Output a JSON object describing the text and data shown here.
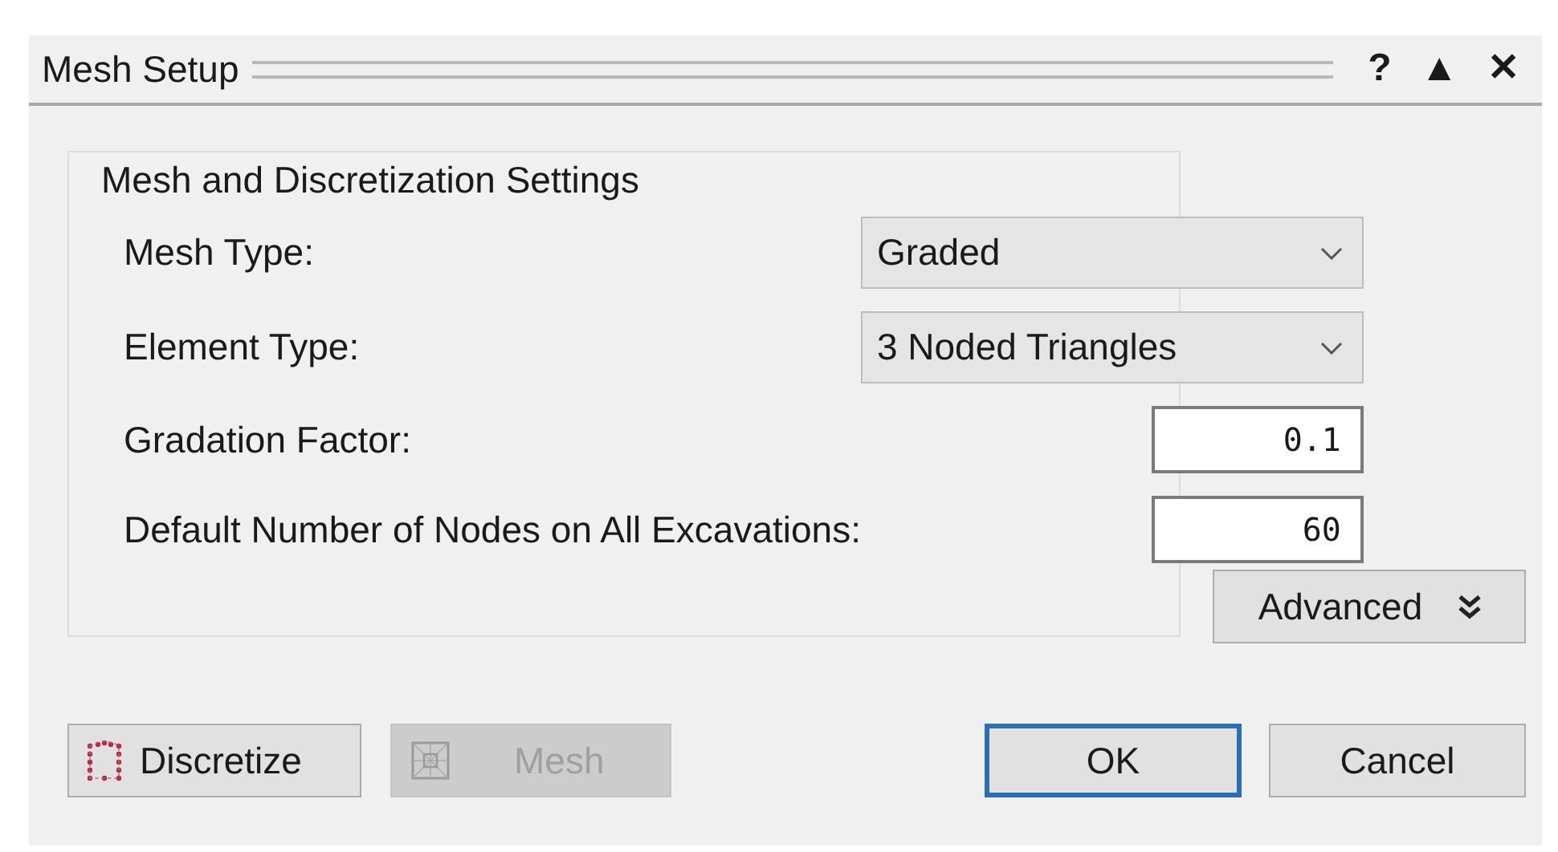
{
  "window": {
    "title": "Mesh Setup",
    "help": "?",
    "collapse": "▲",
    "close": "✕"
  },
  "settings": {
    "title": "Mesh and Discretization Settings",
    "fields": [
      {
        "kind": "dropdown",
        "label": "Mesh Type:",
        "value": "Graded"
      },
      {
        "kind": "dropdown",
        "label": "Element Type:",
        "value": "3 Noded Triangles"
      },
      {
        "kind": "number",
        "label": "Gradation Factor:",
        "value": "0.1"
      },
      {
        "kind": "number",
        "label": "Default Number of Nodes on All Excavations:",
        "value": "60"
      }
    ]
  },
  "advanced": {
    "label": "Advanced",
    "expanded": false
  },
  "buttons": [
    {
      "label": "Discretize",
      "kind": "discretize",
      "disabled": false,
      "default": false
    },
    {
      "label": "Mesh",
      "kind": "mesh",
      "disabled": true,
      "default": false
    },
    {
      "label": "OK",
      "kind": "plain",
      "disabled": false,
      "default": true
    },
    {
      "label": "Cancel",
      "kind": "plain",
      "disabled": false,
      "default": false
    }
  ]
}
